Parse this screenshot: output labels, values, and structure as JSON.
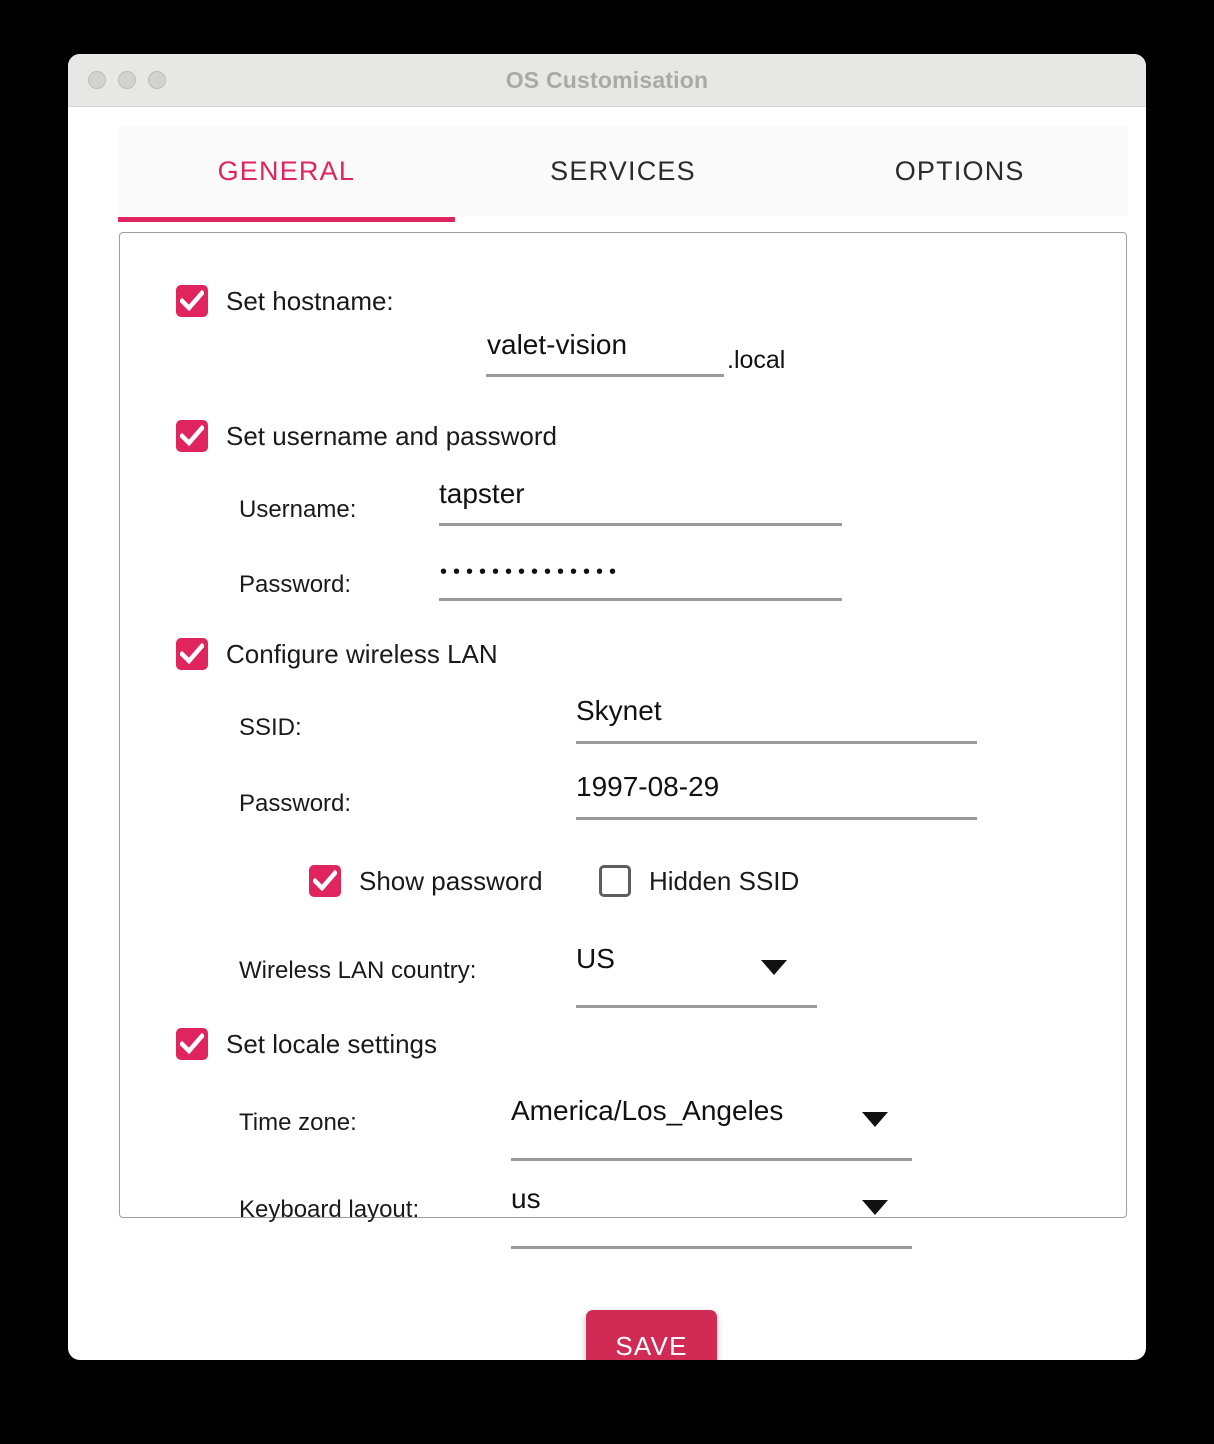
{
  "window": {
    "title": "OS Customisation",
    "traffic_lights": [
      "close-button",
      "minimize-button",
      "zoom-button"
    ]
  },
  "tabs": [
    {
      "label": "GENERAL",
      "active": true
    },
    {
      "label": "SERVICES",
      "active": false
    },
    {
      "label": "OPTIONS",
      "active": false
    }
  ],
  "general": {
    "hostname": {
      "checkbox_label": "Set hostname:",
      "checked": true,
      "value": "valet-vision",
      "suffix": ".local"
    },
    "user": {
      "checkbox_label": "Set username and password",
      "checked": true,
      "username_label": "Username:",
      "username_value": "tapster",
      "password_label": "Password:",
      "password_masked": "••••••••••••••"
    },
    "wifi": {
      "checkbox_label": "Configure wireless LAN",
      "checked": true,
      "ssid_label": "SSID:",
      "ssid_value": "Skynet",
      "password_label": "Password:",
      "password_value": "1997-08-29",
      "show_password_label": "Show password",
      "show_password_checked": true,
      "hidden_ssid_label": "Hidden SSID",
      "hidden_ssid_checked": false,
      "country_label": "Wireless LAN country:",
      "country_value": "US"
    },
    "locale": {
      "checkbox_label": "Set locale settings",
      "checked": true,
      "timezone_label": "Time zone:",
      "timezone_value": "America/Los_Angeles",
      "keyboard_label": "Keyboard layout:",
      "keyboard_value": "us"
    }
  },
  "actions": {
    "save_label": "SAVE"
  },
  "colors": {
    "accent": "#e0245e",
    "save_button": "#d12b55",
    "titlebar": "#e7e7e5",
    "panel_border": "#9e9e9e"
  }
}
